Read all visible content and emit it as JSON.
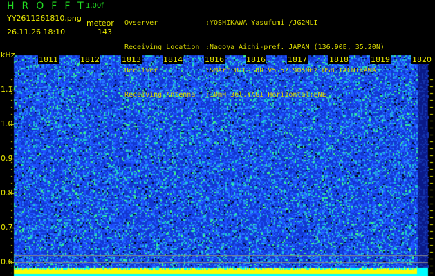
{
  "header": {
    "app_title": "HROFFT",
    "version": "1.00f",
    "filename": "YY2611261810.png",
    "datetime": "26.11.26 18:10",
    "meteor_label": "meteor",
    "meteor_count": "143"
  },
  "info": [
    {
      "label": "Ovserver",
      "value": ":YOSHIKAWA Yasufumi /JG2MLI"
    },
    {
      "label": "Receiving Location",
      "value": ":Nagoya Aichi-pref. JAPAN (136.90E, 35.20N)"
    },
    {
      "label": "Receiver",
      "value": ":SMArt RTL-SDR V5 52.905MHz USB TACHIKAWA"
    },
    {
      "label": "Receiving Antenna",
      "value": ":10mH 3el.YAGI Horizontal:ENE"
    }
  ],
  "spectrogram": {
    "y_unit": "kHz",
    "y_ticks": [
      "1.1",
      "1.0",
      "0.9",
      "0.8",
      "0.7",
      "0.6"
    ],
    "time_labels": [
      "1811",
      "1812",
      "1813",
      "1814",
      "1816",
      "1816",
      "1817",
      "1818",
      "1819",
      "1820"
    ],
    "colors": {
      "bg": "#0a1a8a",
      "noise": "#1e50ff",
      "hot": "#20d0d0",
      "peak": "#40ff80",
      "bar_yellow": "#ffff00",
      "bar_cyan": "#00ffff",
      "label": "#e8e800"
    }
  }
}
